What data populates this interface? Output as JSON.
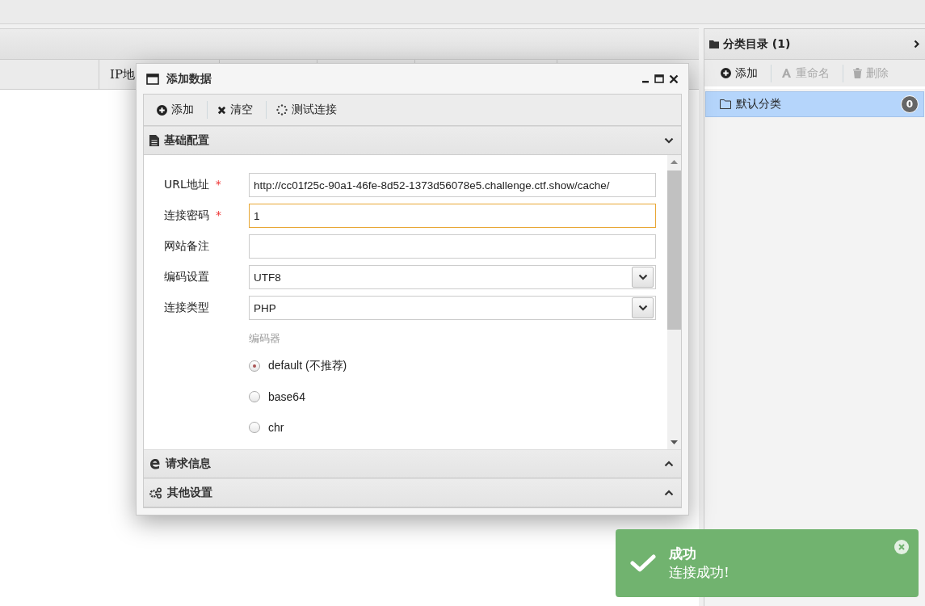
{
  "table": {
    "column_2": "IP地"
  },
  "category_panel": {
    "title": "分类目录 (1)",
    "toolbar": [
      {
        "label": "添加",
        "disabled": false
      },
      {
        "label": "重命名",
        "disabled": true
      },
      {
        "label": "删除",
        "disabled": true
      }
    ],
    "items": [
      {
        "name": "默认分类",
        "count": "0",
        "selected": true
      }
    ]
  },
  "dialog": {
    "title": "添加数据",
    "toolbar": [
      {
        "label": "添加"
      },
      {
        "label": "清空"
      },
      {
        "label": "测试连接"
      }
    ],
    "sections": [
      {
        "title": "基础配置",
        "expanded": true
      },
      {
        "title": "请求信息",
        "expanded": false
      },
      {
        "title": "其他设置",
        "expanded": false
      }
    ],
    "fields": [
      {
        "kind": "text",
        "label": "URL地址",
        "required_mark": "*",
        "focused": false,
        "value": "http://cc01f25c-90a1-46fe-8d52-1373d56078e5.challenge.ctf.show/cache/"
      },
      {
        "kind": "text",
        "label": "连接密码",
        "required_mark": "*",
        "focused": true,
        "value": "1"
      },
      {
        "kind": "text",
        "label": "网站备注",
        "focused": false
      },
      {
        "kind": "select",
        "label": "编码设置",
        "focused": false,
        "value": "UTF8"
      },
      {
        "kind": "select",
        "label": "连接类型",
        "focused": false,
        "value": "PHP"
      }
    ],
    "encoder": {
      "label": "编码器",
      "options": [
        {
          "label": "default (不推荐)",
          "selected": true
        },
        {
          "label": "base64",
          "selected": false
        },
        {
          "label": "chr",
          "selected": false
        }
      ]
    }
  },
  "toast": {
    "kind": "success",
    "title": "成功",
    "message": "连接成功!"
  }
}
